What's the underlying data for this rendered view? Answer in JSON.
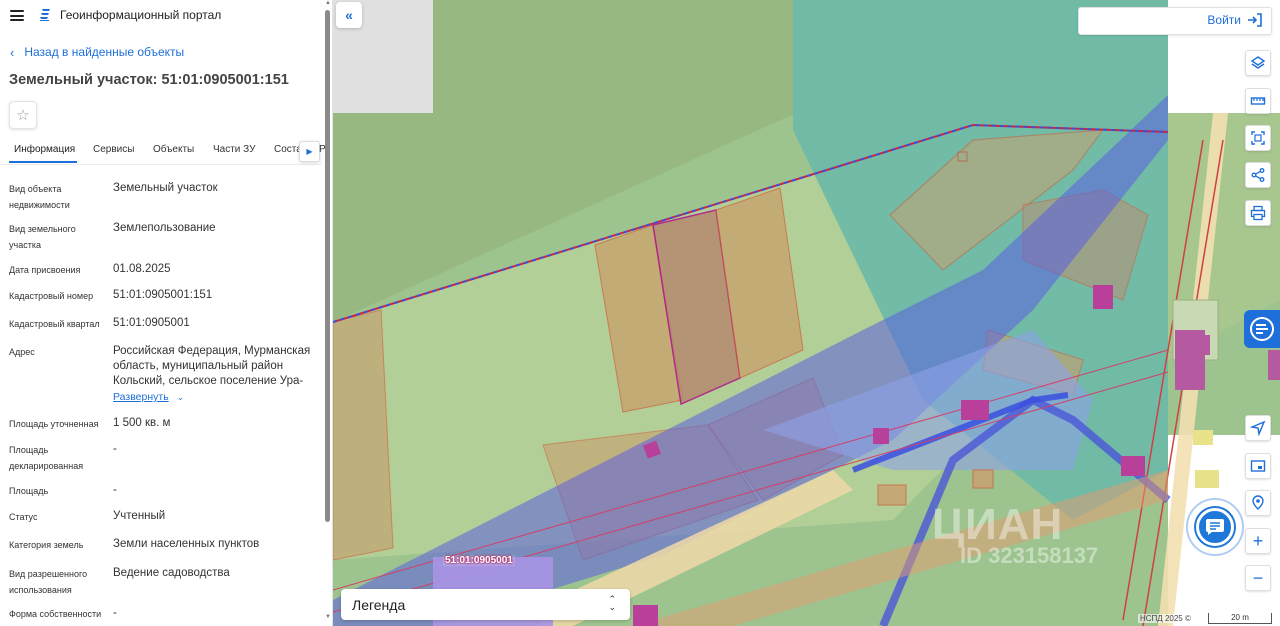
{
  "header": {
    "portal_title": "Геоинформационный портал"
  },
  "back_link": "Назад в найденные объекты",
  "parcel_title": "Земельный участок: 51:01:0905001:151",
  "tabs": [
    {
      "label": "Информация",
      "active": true
    },
    {
      "label": "Сервисы"
    },
    {
      "label": "Объекты"
    },
    {
      "label": "Части ЗУ"
    },
    {
      "label": "Соста"
    },
    {
      "label": "Р"
    }
  ],
  "properties": [
    {
      "label": "Вид объекта недвижимости",
      "value": "Земельный участок"
    },
    {
      "label": "Вид земельного участка",
      "value": "Землепользование"
    },
    {
      "label": "Дата присвоения",
      "value": "01.08.2025"
    },
    {
      "label": "Кадастровый номер",
      "value": "51:01:0905001:151"
    },
    {
      "label": "Кадастровый квартал",
      "value": "51:01:0905001"
    },
    {
      "label": "Адрес",
      "value": "Российская Федерация, Мурманская область, муниципальный район Кольский, сельское поселение Ура-"
    },
    {
      "label": "Площадь уточненная",
      "value": "1 500 кв. м"
    },
    {
      "label": "Площадь декларированная",
      "value": "-"
    },
    {
      "label": "Площадь",
      "value": "-"
    },
    {
      "label": "Статус",
      "value": "Учтенный"
    },
    {
      "label": "Категория земель",
      "value": "Земли населенных пунктов"
    },
    {
      "label": "Вид разрешенного использования",
      "value": "Ведение садоводства"
    },
    {
      "label": "Форма собственности",
      "value": "-"
    }
  ],
  "expand_label": "Развернуть",
  "map": {
    "login_label": "Войти",
    "legend_label": "Легенда",
    "quarter_label": "51:01:0905001",
    "watermark": "ЦИАН",
    "watermark_id": "ID 323158137",
    "attribution": "НСПД 2025 ©",
    "scale_label": "20 m",
    "tools": [
      "layers-icon",
      "ruler-icon",
      "select-area-icon",
      "share-icon",
      "print-icon"
    ],
    "nav_tools": [
      "locate-icon",
      "minimap-icon",
      "geolocation-icon"
    ]
  },
  "colors": {
    "accent": "#1e6fd9",
    "parcel_line": "#d0603a",
    "highlight_border": "#b0128a",
    "zone_blue": "#5b5ee0"
  }
}
